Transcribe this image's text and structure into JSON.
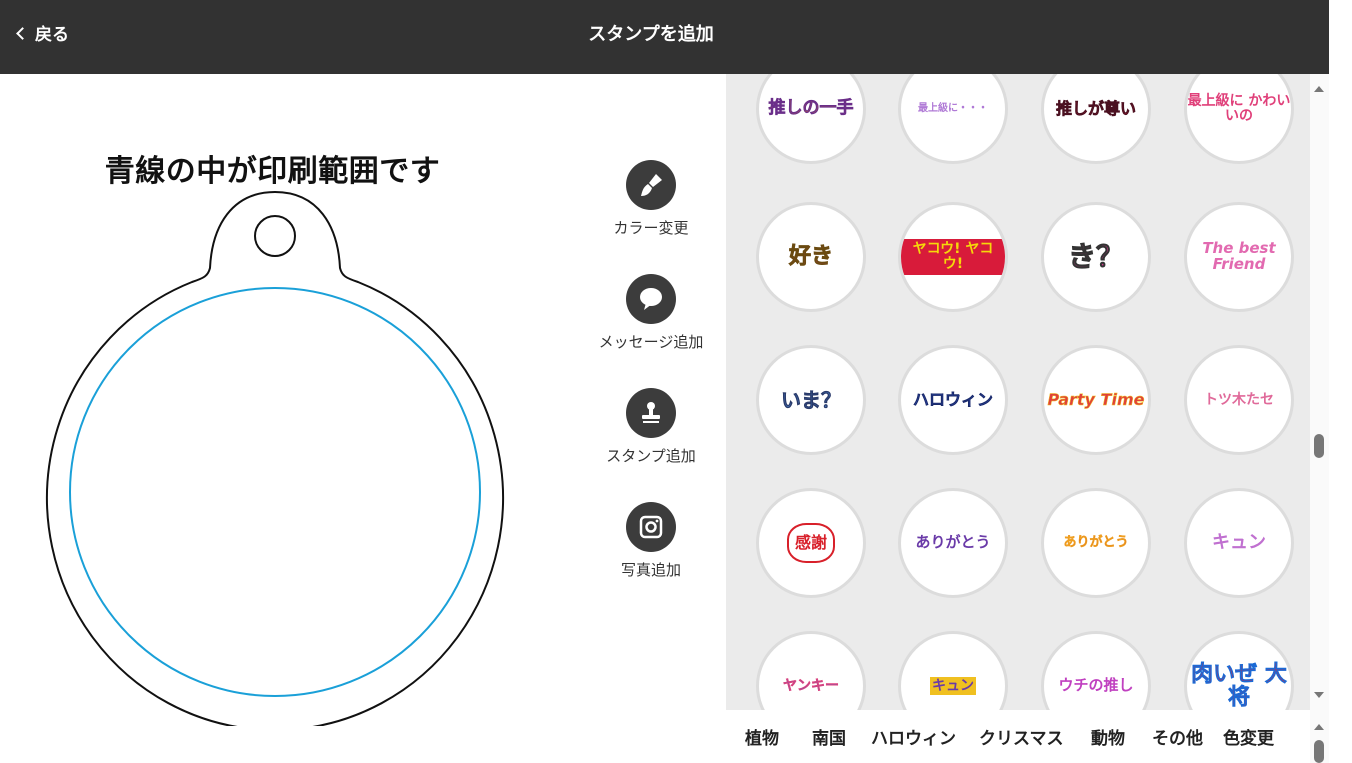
{
  "header": {
    "back_label": "戻る",
    "title": "スタンプを追加"
  },
  "canvas": {
    "caption": "青線の中が印刷範囲です",
    "print_area_color": "#1aa0d8"
  },
  "tools": [
    {
      "label": "カラー変更",
      "icon": "paint-brush-icon"
    },
    {
      "label": "メッセージ追加",
      "icon": "speech-bubble-icon"
    },
    {
      "label": "スタンプ追加",
      "icon": "stamp-icon"
    },
    {
      "label": "写真追加",
      "icon": "camera-icon"
    }
  ],
  "stamps": [
    [
      "推しの一手",
      "最上級に・・・",
      "推しが尊い",
      "最上級に かわいいの"
    ],
    [
      "好き",
      "ヤコウ! ヤコウ!",
      "き？",
      "The best Friend"
    ],
    [
      "いま？",
      "ハロウィン",
      "Party Time",
      "トツ木たセ"
    ],
    [
      "感謝",
      "ありがとう",
      "ありがとう",
      "キュン"
    ],
    [
      "ヤンキー",
      "キュン",
      "ウチの推し",
      "肉いぜ 大将"
    ]
  ],
  "categories": [
    "植物",
    "南国",
    "ハロウィン",
    "クリスマス",
    "動物",
    "その他",
    "色変更"
  ]
}
